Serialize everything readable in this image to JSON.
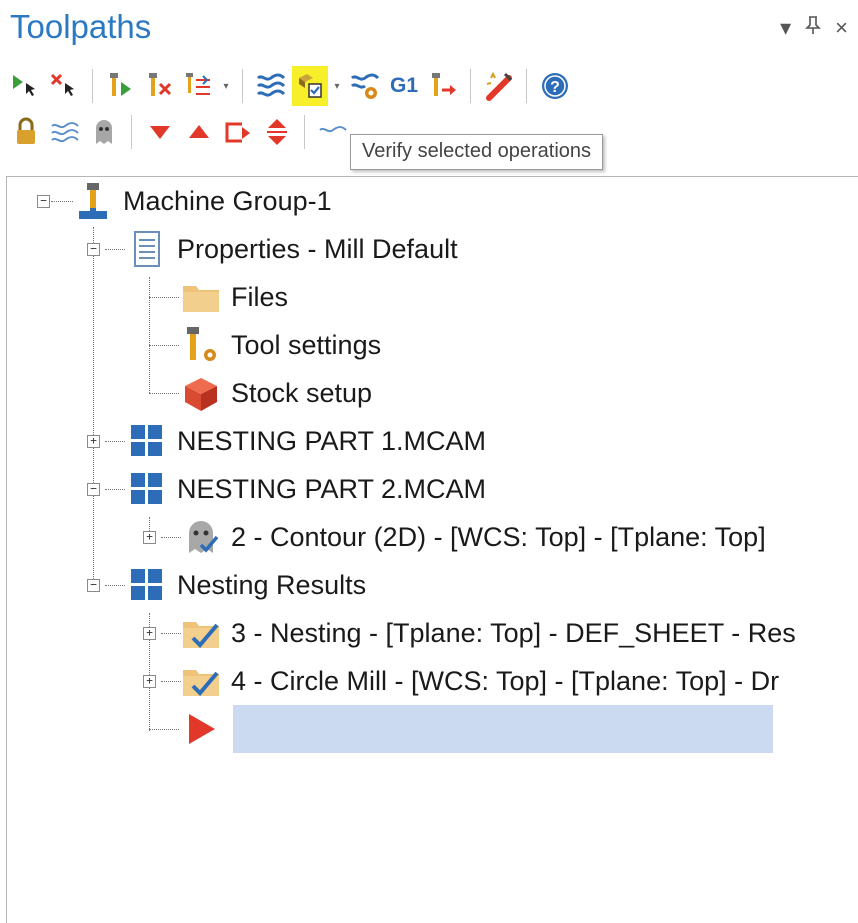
{
  "panel": {
    "title": "Toolpaths",
    "controls": {
      "dropdown": "▾",
      "pin": "ꟷ",
      "close": "×"
    }
  },
  "toolbar_row1": [
    {
      "icon": "select-all-operations-icon"
    },
    {
      "icon": "deselect-all-icon"
    },
    {
      "icon": "regenerate-selected-icon"
    },
    {
      "icon": "regenerate-dirty-icon"
    },
    {
      "icon": "edit-operations-icon"
    },
    {
      "icon": "backplot-selected-icon"
    },
    {
      "icon": "verify-selected-icon",
      "highlighted": true
    },
    {
      "icon": "simulate-icon"
    },
    {
      "icon": "post-selected-icon",
      "text": "G1"
    },
    {
      "icon": "highfeed-icon"
    },
    {
      "icon": "delete-all-icon"
    },
    {
      "icon": "help-icon"
    }
  ],
  "toolbar_row2": [
    {
      "icon": "lock-icon"
    },
    {
      "icon": "toggle-display-icon"
    },
    {
      "icon": "toggle-posting-icon"
    },
    {
      "icon": "move-down-icon"
    },
    {
      "icon": "move-up-icon"
    },
    {
      "icon": "insert-arrow-icon"
    },
    {
      "icon": "scroll-arrows-icon"
    }
  ],
  "tooltip": {
    "text": "Verify selected operations"
  },
  "tree": [
    {
      "id": "machine_group",
      "label": "Machine Group-1",
      "icon": "machine-group-icon"
    },
    {
      "id": "properties",
      "label": "Properties - Mill Default",
      "icon": "properties-icon"
    },
    {
      "id": "files",
      "label": "Files",
      "icon": "folder-icon"
    },
    {
      "id": "tool_settings",
      "label": "Tool settings",
      "icon": "tool-settings-icon"
    },
    {
      "id": "stock_setup",
      "label": "Stock setup",
      "icon": "stock-box-icon"
    },
    {
      "id": "nesting_part1",
      "label": "NESTING PART 1.MCAM",
      "icon": "nesting-group-icon"
    },
    {
      "id": "nesting_part2",
      "label": "NESTING PART 2.MCAM",
      "icon": "nesting-group-icon"
    },
    {
      "id": "contour",
      "label": "2 - Contour (2D) - [WCS: Top] - [Tplane: Top]",
      "icon": "contour-operation-icon"
    },
    {
      "id": "nesting_results",
      "label": "Nesting Results",
      "icon": "nesting-group-icon"
    },
    {
      "id": "nesting_op",
      "label": "3 - Nesting - [Tplane: Top] - DEF_SHEET - Res",
      "icon": "operation-folder-check-icon"
    },
    {
      "id": "circle_mill",
      "label": "4 - Circle Mill - [WCS: Top] - [Tplane: Top] - Dr",
      "icon": "operation-folder-check-icon"
    },
    {
      "id": "insert_arrow",
      "label": "",
      "icon": "insert-arrow-icon"
    }
  ],
  "colors": {
    "title": "#2b79c2",
    "highlight": "#f6ef2a",
    "selection": "#ccdaf1",
    "arrow_red": "#e1382a",
    "blue_icon": "#2d6db8"
  }
}
